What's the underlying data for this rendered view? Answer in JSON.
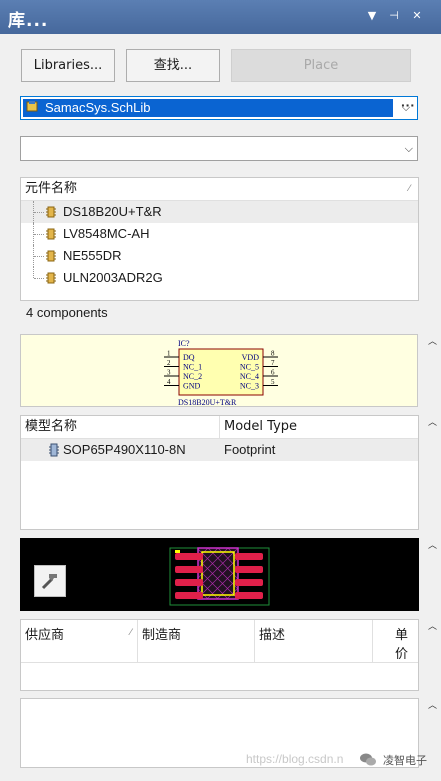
{
  "window": {
    "title": "库..."
  },
  "toolbar": {
    "libraries_label": "Libraries...",
    "search_label": "查找...",
    "place_label": "Place"
  },
  "library_select": {
    "value": "SamacSys.SchLib"
  },
  "filter_select": {
    "value": ""
  },
  "components": {
    "header": "元件名称",
    "items": [
      {
        "label": "DS18B20U+T&R",
        "selected": true
      },
      {
        "label": "LV8548MC-AH",
        "selected": false
      },
      {
        "label": "NE555DR",
        "selected": false
      },
      {
        "label": "ULN2003ADR2G",
        "selected": false
      }
    ],
    "count_label": "4 components"
  },
  "symbol_preview": {
    "designator": "IC?",
    "name": "DS18B20U+T&R",
    "left_pins": [
      {
        "num": "1",
        "name": "DQ"
      },
      {
        "num": "2",
        "name": "NC_1"
      },
      {
        "num": "3",
        "name": "NC_2"
      },
      {
        "num": "4",
        "name": "GND"
      }
    ],
    "right_pins": [
      {
        "num": "8",
        "name": "VDD"
      },
      {
        "num": "7",
        "name": "NC_5"
      },
      {
        "num": "6",
        "name": "NC_4"
      },
      {
        "num": "5",
        "name": "NC_3"
      }
    ]
  },
  "models": {
    "col1": "模型名称",
    "col2": "Model Type",
    "rows": [
      {
        "name": "SOP65P490X110-8N",
        "type": "Footprint"
      }
    ]
  },
  "suppliers": {
    "cols": [
      "供应商",
      "制造商",
      "描述",
      "单价"
    ]
  },
  "watermark": {
    "url": "https://blog.csdn.n",
    "brand": "凌智电子"
  },
  "colors": {
    "titlebar": "#4f74a8",
    "selection": "#0a64d2",
    "preview_bg": "#ffffe1",
    "symbol_body": "#ffffb0",
    "symbol_border": "#8b0000",
    "pin_text": "#000080",
    "pad": "#e0204a",
    "silk": "#ffff00",
    "outline": "#cc33cc"
  }
}
